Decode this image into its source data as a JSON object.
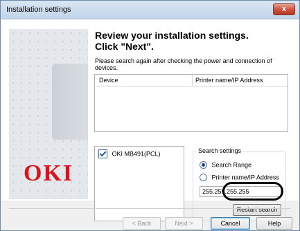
{
  "window": {
    "title": "Installation settings",
    "close_label": "x"
  },
  "banner": {
    "logo_text": "OKI"
  },
  "main": {
    "heading": "Review your installation settings.\nClick \"Next\".",
    "instruction": "Please search again after checking the power and connection of devices."
  },
  "device_table": {
    "columns": [
      "Device",
      "Printer name/IP Address"
    ]
  },
  "device_list": {
    "items": [
      {
        "label": "OKI MB491(PCL)",
        "checked": true
      }
    ]
  },
  "search_settings": {
    "title": "Search settings",
    "options": [
      {
        "label": "Search Range",
        "selected": true
      },
      {
        "label": "Printer name/IP Address",
        "selected": false
      }
    ],
    "address_value": "255.255.255.255",
    "restart_label": "Restart search"
  },
  "footer": {
    "back_label": "< Back",
    "next_label": "Next >",
    "cancel_label": "Cancel",
    "help_label": "Help"
  },
  "colors": {
    "logo_red": "#d8141c",
    "title_bar": "#c2d5ea",
    "close_red": "#c9503c"
  }
}
